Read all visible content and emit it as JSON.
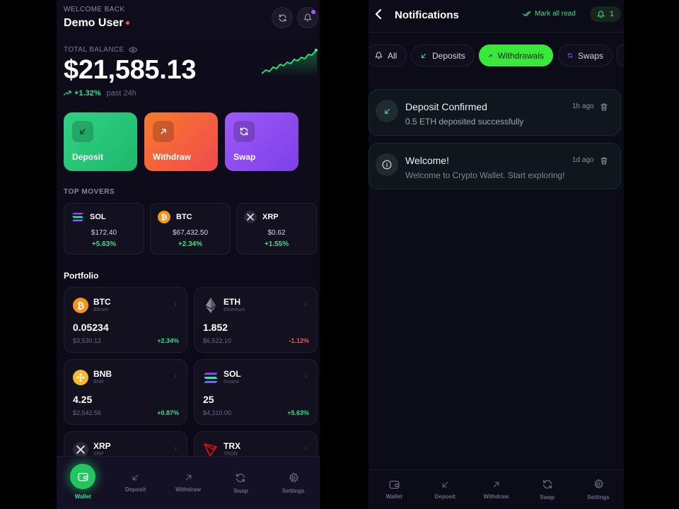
{
  "wallet": {
    "welcome": "WELCOME BACK",
    "user_name": "Demo User",
    "balance_label": "TOTAL BALANCE",
    "balance": "$21,585.13",
    "change": "+1.32%",
    "period": "past 24h",
    "actions": [
      {
        "label": "Deposit",
        "icon": "arrow-down-left-icon"
      },
      {
        "label": "Withdraw",
        "icon": "arrow-up-right-icon"
      },
      {
        "label": "Swap",
        "icon": "swap-icon"
      }
    ],
    "top_movers_title": "TOP MOVERS",
    "movers": [
      {
        "symbol": "SOL",
        "price": "$172.40",
        "change": "+5.63%"
      },
      {
        "symbol": "BTC",
        "price": "$67,432.50",
        "change": "+2.34%"
      },
      {
        "symbol": "XRP",
        "price": "$0.62",
        "change": "+1.55%"
      }
    ],
    "portfolio_title": "Portfolio",
    "portfolio": [
      {
        "symbol": "BTC",
        "name": "Bitcoin",
        "amount": "0.05234",
        "usd": "$3,530.12",
        "change": "+2.34%"
      },
      {
        "symbol": "ETH",
        "name": "Ethereum",
        "amount": "1.852",
        "usd": "$6,522.10",
        "change": "-1.12%"
      },
      {
        "symbol": "BNB",
        "name": "BNB",
        "amount": "4.25",
        "usd": "$2,542.56",
        "change": "+0.87%"
      },
      {
        "symbol": "SOL",
        "name": "Solana",
        "amount": "25",
        "usd": "$4,310.00",
        "change": "+5.63%"
      },
      {
        "symbol": "XRP",
        "name": "XRP",
        "amount": "",
        "usd": "",
        "change": ""
      },
      {
        "symbol": "TRX",
        "name": "TRON",
        "amount": "",
        "usd": "",
        "change": ""
      }
    ],
    "nav": [
      "Wallet",
      "Deposit",
      "Withdraw",
      "Swap",
      "Settings"
    ]
  },
  "notifications": {
    "title": "Notifications",
    "mark_all": "Mark all read",
    "unread_count": "1",
    "tabs": [
      "All",
      "Deposits",
      "Withdrawals",
      "Swaps"
    ],
    "active_tab": "Withdrawals",
    "items": [
      {
        "title": "Deposit Confirmed",
        "message": "0.5 ETH deposited successfully",
        "time": "1h ago",
        "icon": "arrow-down-left-icon"
      },
      {
        "title": "Welcome!",
        "message": "Welcome to Crypto Wallet. Start exploring!",
        "time": "1d ago",
        "icon": "info-icon"
      }
    ],
    "nav": [
      "Wallet",
      "Deposit",
      "Withdraw",
      "Swap",
      "Settings"
    ]
  },
  "colors": {
    "accent_green": "#3ddc84",
    "negative_red": "#ef5a4e",
    "deposit_card": "#2fd184",
    "withdraw_card": "#f87b2b",
    "swap_card": "#9d5af7",
    "active_tab": "#39e83b"
  }
}
